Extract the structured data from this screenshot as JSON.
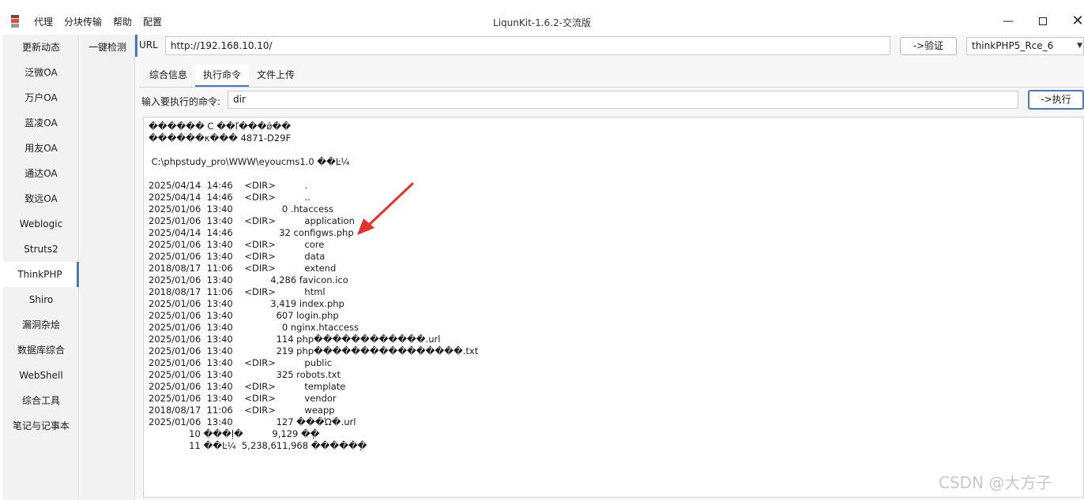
{
  "window": {
    "title": "LiqunKit-1.6.2-交流版",
    "menu": [
      "代理",
      "分块传输",
      "帮助",
      "配置"
    ],
    "minimize_glyph": "—",
    "close_glyph": "✕"
  },
  "sidebar": {
    "items": [
      "更新动态",
      "泛微OA",
      "万户OA",
      "蓝凌OA",
      "用友OA",
      "通达OA",
      "致远OA",
      "Weblogic",
      "Struts2",
      "ThinkPHP",
      "Shiro",
      "漏洞杂烩",
      "数据库综合",
      "WebShell",
      "综合工具",
      "笔记与记事本"
    ],
    "active_index": 9
  },
  "secondary": {
    "item": "一键检测"
  },
  "url_bar": {
    "label": "URL",
    "value": "http://192.168.10.10/",
    "verify_label": "->验证",
    "exploit_selected": "thinkPHP5_Rce_6"
  },
  "tabs": {
    "items": [
      "综合信息",
      "执行命令",
      "文件上传"
    ],
    "active_index": 1
  },
  "command": {
    "label": "输入要执行的命令:",
    "value": "dir",
    "exec_label": "->执行"
  },
  "output": {
    "lines": [
      "������ C ��ľ���ǿ��",
      "������κ��� 4871-D29F",
      "",
      " C:\\phpstudy_pro\\WWW\\eyoucms1.0 ��Ŀ¼",
      "",
      "2025/04/14  14:46    <DIR>          .",
      "2025/04/14  14:46    <DIR>          ..",
      "2025/01/06  13:40                 0 .htaccess",
      "2025/01/06  13:40    <DIR>          application",
      "2025/04/14  14:46                32 configws.php",
      "2025/01/06  13:40    <DIR>          core",
      "2025/01/06  13:40    <DIR>          data",
      "2018/08/17  11:06    <DIR>          extend",
      "2025/01/06  13:40             4,286 favicon.ico",
      "2018/08/17  11:06    <DIR>          html",
      "2025/01/06  13:40             3,419 index.php",
      "2025/01/06  13:40               607 login.php",
      "2025/01/06  13:40                 0 nginx.htaccess",
      "2025/01/06  13:40               114 php������������.url",
      "2025/01/06  13:40               219 php����������������.txt",
      "2025/01/06  13:40    <DIR>          public",
      "2025/01/06  13:40               325 robots.txt",
      "2025/01/06  13:40    <DIR>          template",
      "2025/01/06  13:40    <DIR>          vendor",
      "2018/08/17  11:06    <DIR>          weapp",
      "2025/01/06  13:40               127 ���Ὠ�.url",
      "              10 ���ļ�          9,129 �ֽ�",
      "              11 ��Ŀ¼  5,238,611,968 �����ֽ�"
    ]
  },
  "annotation": {
    "arrow_color": "#e8312b"
  },
  "watermark": "CSDN @大方子"
}
